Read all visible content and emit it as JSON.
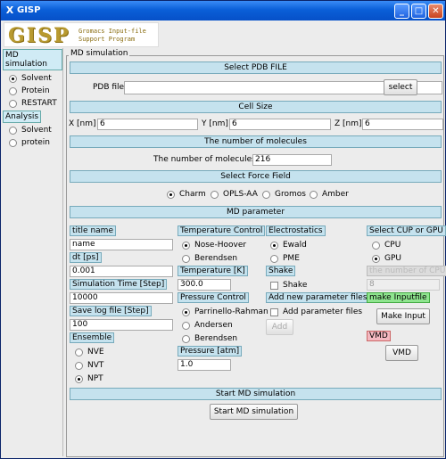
{
  "window": {
    "title": "GISP"
  },
  "logo": {
    "text": "GISP",
    "subtitle_line1": "Gromacs Input-file",
    "subtitle_line2": "Support Program"
  },
  "sidebar": {
    "md_label": "MD simulation",
    "md_items": [
      {
        "label": "Solvent",
        "selected": true
      },
      {
        "label": "Protein",
        "selected": false
      },
      {
        "label": "RESTART",
        "selected": false
      }
    ],
    "analysis_label": "Analysis",
    "analysis_items": [
      {
        "label": "Solvent",
        "selected": false
      },
      {
        "label": "protein",
        "selected": false
      }
    ]
  },
  "main": {
    "legend": "MD simulation",
    "pdb": {
      "header": "Select PDB FILE",
      "label": "PDB file",
      "value": "",
      "button": "select"
    },
    "cell": {
      "header": "Cell Size",
      "x_label": "X [nm]",
      "x_value": "6",
      "y_label": "Y [nm]",
      "y_value": "6",
      "z_label": "Z [nm]",
      "z_value": "6"
    },
    "molecules": {
      "header": "The number of molecules",
      "label": "The number of molecules",
      "value": "216"
    },
    "forcefield": {
      "header": "Select Force Field",
      "options": [
        {
          "label": "Charm",
          "selected": true
        },
        {
          "label": "OPLS-AA",
          "selected": false
        },
        {
          "label": "Gromos",
          "selected": false
        },
        {
          "label": "Amber",
          "selected": false
        }
      ]
    },
    "mdparam": {
      "header": "MD parameter",
      "title_label": "title name",
      "title_value": "name",
      "dt_label": "dt [ps]",
      "dt_value": "0.001",
      "simtime_label": "Simulation Time [Step]",
      "simtime_value": "10000",
      "savelog_label": "Save log file [Step]",
      "savelog_value": "100",
      "ensemble_label": "Ensemble",
      "ensemble_options": [
        {
          "label": "NVE",
          "selected": false
        },
        {
          "label": "NVT",
          "selected": false
        },
        {
          "label": "NPT",
          "selected": true
        }
      ],
      "temp_control_label": "Temperature Control",
      "temp_control_options": [
        {
          "label": "Nose-Hoover",
          "selected": true
        },
        {
          "label": "Berendsen",
          "selected": false
        }
      ],
      "temperature_label": "Temperature [K]",
      "temperature_value": "300.0",
      "pressure_control_label": "Pressure Control",
      "pressure_control_options": [
        {
          "label": "Parrinello-Rahman",
          "selected": true
        },
        {
          "label": "Andersen",
          "selected": false
        },
        {
          "label": "Berendsen",
          "selected": false
        }
      ],
      "pressure_label": "Pressure [atm]",
      "pressure_value": "1.0",
      "electro_label": "Electrostatics",
      "electro_options": [
        {
          "label": "Ewald",
          "selected": true
        },
        {
          "label": "PME",
          "selected": false
        }
      ],
      "shake_label": "Shake",
      "shake_check": "Shake",
      "addparam_label": "Add new parameter files",
      "addparam_check": "Add parameter files",
      "add_button": "Add",
      "cpu_label": "Select CUP or GPU",
      "cpu_options": [
        {
          "label": "CPU",
          "selected": false
        },
        {
          "label": "GPU",
          "selected": true
        }
      ],
      "ncpu_label": "the number of CPU",
      "ncpu_value": "8",
      "makeinput_label": "make Inputfile",
      "makeinput_button": "Make Input",
      "vmd_label": "VMD",
      "vmd_button": "VMD"
    },
    "start": {
      "header": "Start MD simulation",
      "button": "Start MD simulation"
    }
  }
}
